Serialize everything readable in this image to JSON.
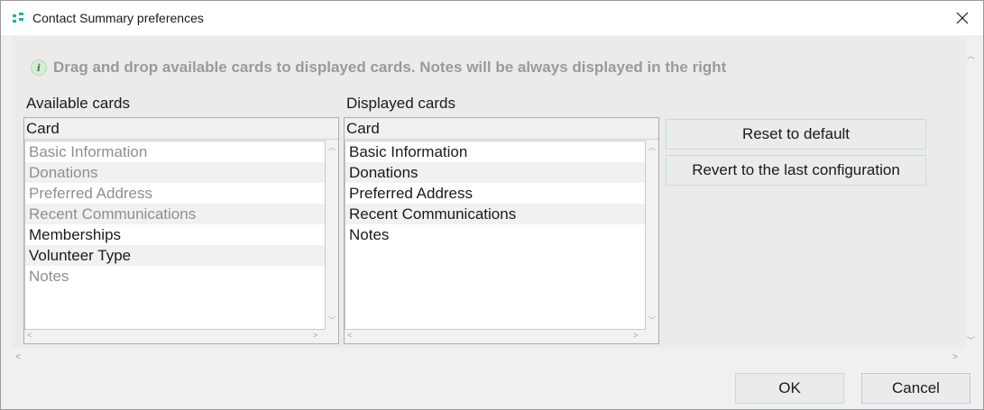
{
  "window": {
    "title": "Contact Summary preferences"
  },
  "info": {
    "text": "Drag and drop available cards to displayed cards. Notes will be always displayed in the right"
  },
  "available": {
    "label": "Available cards",
    "column_header": "Card",
    "items": [
      {
        "label": "Basic Information",
        "enabled": false
      },
      {
        "label": "Donations",
        "enabled": false
      },
      {
        "label": "Preferred Address",
        "enabled": false
      },
      {
        "label": "Recent Communications",
        "enabled": false
      },
      {
        "label": "Memberships",
        "enabled": true
      },
      {
        "label": "Volunteer Type",
        "enabled": true
      },
      {
        "label": "Notes",
        "enabled": false
      }
    ]
  },
  "displayed": {
    "label": "Displayed cards",
    "column_header": "Card",
    "items": [
      {
        "label": "Basic Information",
        "enabled": true
      },
      {
        "label": "Donations",
        "enabled": true
      },
      {
        "label": "Preferred Address",
        "enabled": true
      },
      {
        "label": "Recent Communications",
        "enabled": true
      },
      {
        "label": "Notes",
        "enabled": true
      }
    ]
  },
  "actions": {
    "reset_label": "Reset to default",
    "revert_label": "Revert to the last configuration"
  },
  "footer": {
    "ok_label": "OK",
    "cancel_label": "Cancel"
  },
  "icons": {
    "app": "app-logo-icon",
    "close": "close-icon",
    "info": "info-icon"
  },
  "colors": {
    "accent_teal": "#1ab0a8",
    "button_border": "#b9dfe3",
    "cancel_border": "#c9c2e6"
  }
}
